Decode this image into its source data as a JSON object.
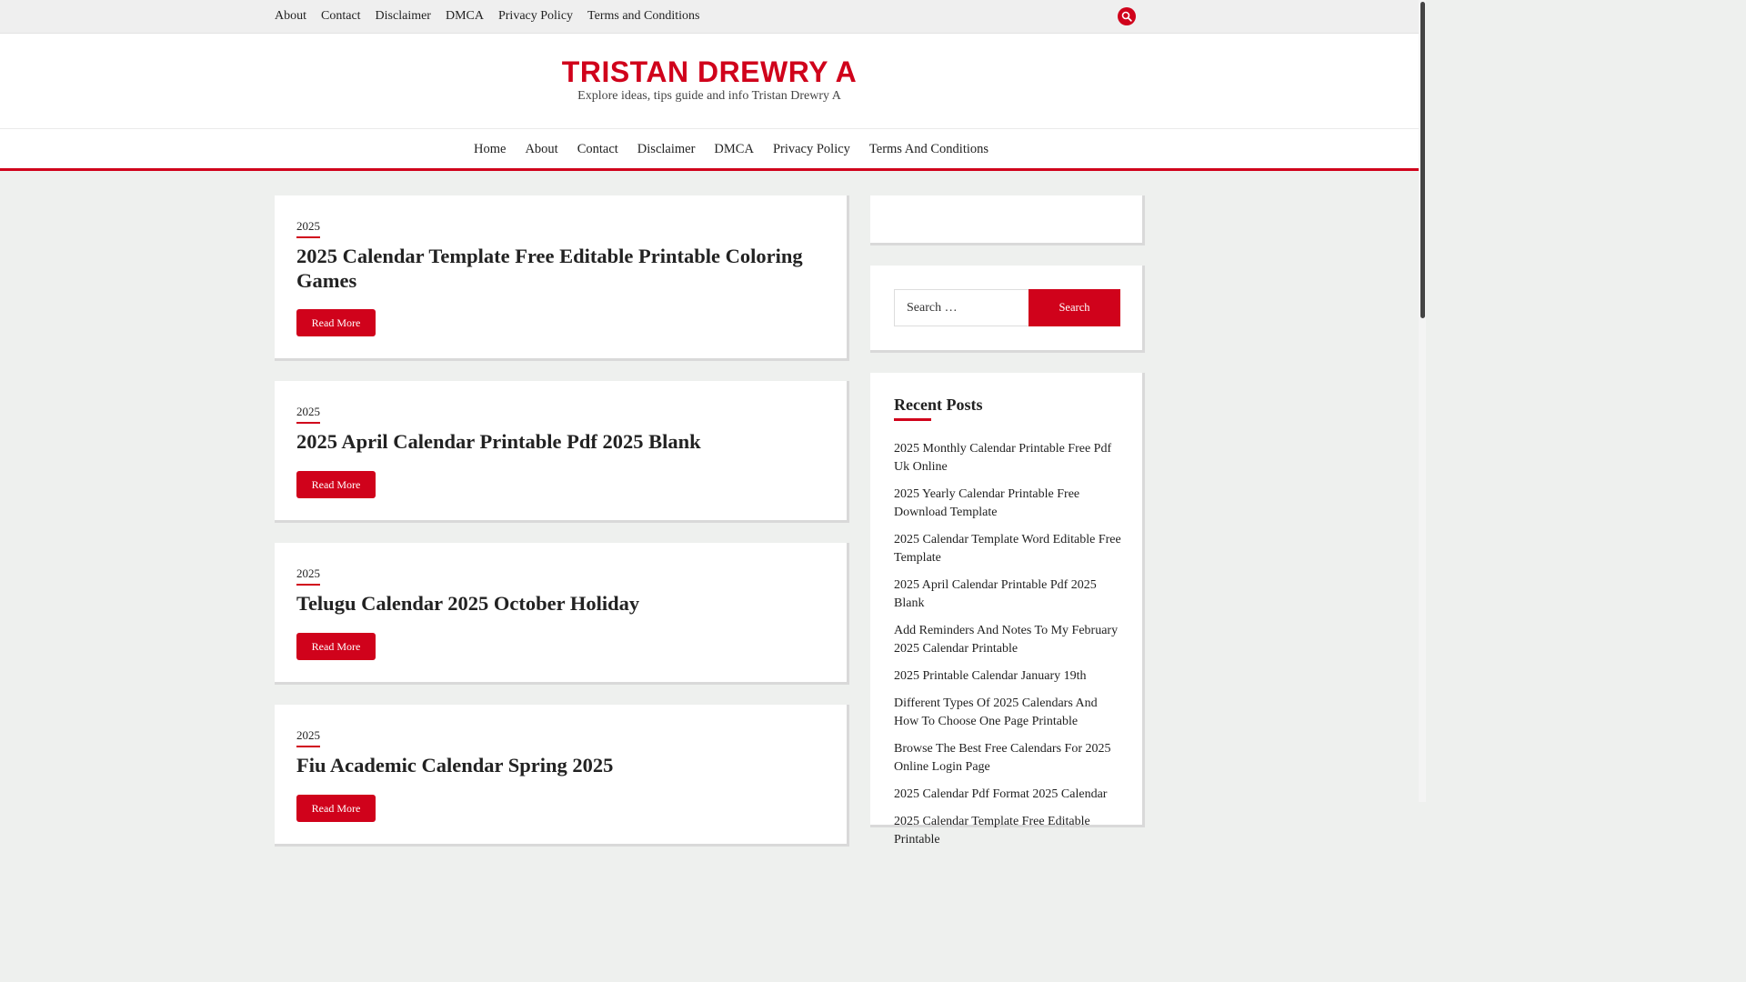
{
  "topbar": {
    "links": [
      "About",
      "Contact",
      "Disclaimer",
      "DMCA",
      "Privacy Policy",
      "Terms and Conditions"
    ],
    "search_icon": "search-icon"
  },
  "header": {
    "title": "TRISTAN DREWRY A",
    "tagline": "Explore ideas, tips guide and info Tristan Drewry A"
  },
  "main_nav": {
    "items": [
      "Home",
      "About",
      "Contact",
      "Disclaimer",
      "DMCA",
      "Privacy Policy",
      "Terms And Conditions"
    ]
  },
  "posts": [
    {
      "category": "2025",
      "title": "2025 Calendar Template Free Editable Printable Coloring Games",
      "read_more": "Read More"
    },
    {
      "category": "2025",
      "title": "2025 April Calendar Printable Pdf 2025 Blank",
      "read_more": "Read More"
    },
    {
      "category": "2025",
      "title": "Telugu Calendar 2025 October Holiday",
      "read_more": "Read More"
    },
    {
      "category": "2025",
      "title": "Fiu Academic Calendar Spring 2025",
      "read_more": "Read More"
    }
  ],
  "sidebar": {
    "search": {
      "placeholder": "Search …",
      "button": "Search"
    },
    "recent_posts": {
      "title": "Recent Posts",
      "items": [
        "2025 Monthly Calendar Printable Free Pdf Uk Online",
        "2025 Yearly Calendar Printable Free Download Template",
        "2025 Calendar Template Word Editable Free Template",
        "2025 April Calendar Printable Pdf 2025 Blank",
        "Add Reminders And Notes To My February 2025 Calendar Printable",
        "2025 Printable Calendar January 19th",
        "Different Types Of 2025 Calendars And How To Choose One Page Printable",
        "Browse The Best Free Calendars For 2025 Online Login Page",
        "2025 Calendar Pdf Format 2025 Calendar",
        "2025 Calendar Template Free Editable Printable"
      ]
    }
  },
  "colors": {
    "accent": "#d0021b",
    "background": "#eef0ee"
  }
}
